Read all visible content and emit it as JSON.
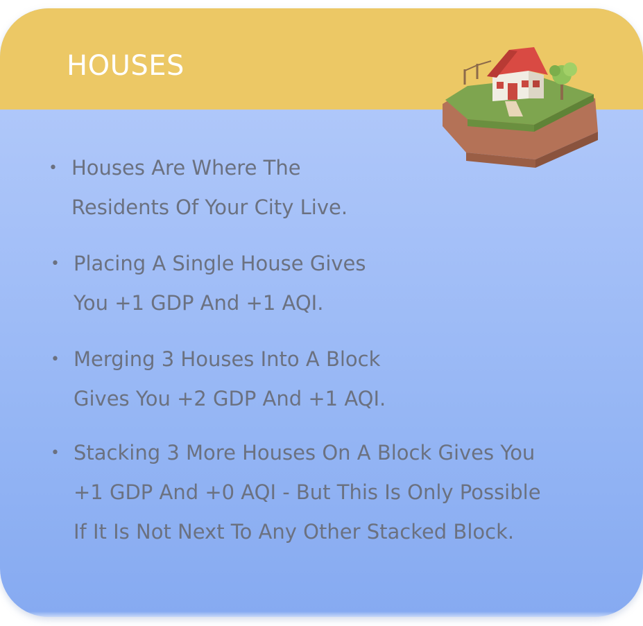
{
  "card": {
    "title": "HOUSES",
    "illustration": "house-on-hexagon-tile-icon",
    "colors": {
      "header": "#ecc865",
      "body_top": "#b7cdfb",
      "body_bottom": "#86aaf1",
      "text": "#6b7180",
      "title_text": "#ffffff"
    },
    "bullets": [
      {
        "lines": [
          "Houses Are Where The",
          "Residents Of Your City Live."
        ]
      },
      {
        "lines": [
          "Placing A Single House Gives",
          "You +1 GDP And +1 AQI."
        ]
      },
      {
        "lines": [
          "Merging 3 Houses Into A Block",
          "Gives You +2 GDP And +1 AQI."
        ]
      },
      {
        "lines": [
          "Stacking 3 More Houses On A Block Gives You",
          "+1 GDP And +0 AQI - But This Is Only Possible",
          "If It Is Not Next To Any Other Stacked Block."
        ]
      }
    ]
  }
}
